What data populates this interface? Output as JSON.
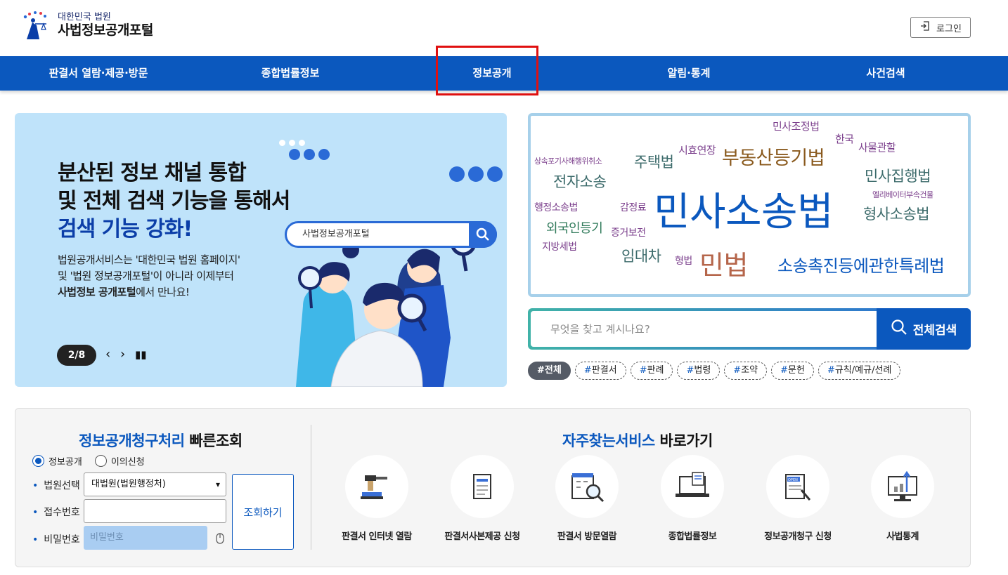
{
  "header": {
    "logo_small": "대한민국 법원",
    "logo_big": "사법정보공개포털",
    "login_label": "로그인"
  },
  "nav": [
    "판결서 열람·제공·방문",
    "종합법률정보",
    "정보공개",
    "알림·통계",
    "사건검색"
  ],
  "banner": {
    "title_line1": "분산된 정보 채널 통합",
    "title_line2": "및 전체 검색 기능을 통해서",
    "title_line3": "검색 기능 강화!",
    "desc_line1": "법원공개서비스는 '대한민국 법원 홈페이지'",
    "desc_line2": "및 '법원 정보공개포털'이 아니라 이제부터",
    "desc_line3_bold": "사법정보 공개포털",
    "desc_line3_rest": "에서 만나요!",
    "search_text": "사법정보공개포털",
    "pager": "2/8"
  },
  "word_cloud": [
    {
      "text": "민사조정법",
      "color": "#7b3f8c"
    },
    {
      "text": "한국",
      "color": "#7b3f8c"
    },
    {
      "text": "사물관할",
      "color": "#7b3f8c"
    },
    {
      "text": "시효연장",
      "color": "#7b3f8c"
    },
    {
      "text": "부동산등기법",
      "color": "#8a5a1e"
    },
    {
      "text": "상속포기사해행위취소",
      "color": "#7b3f8c"
    },
    {
      "text": "주택법",
      "color": "#3c6b6b"
    },
    {
      "text": "민사집행법",
      "color": "#3c6b6b"
    },
    {
      "text": "전자소송",
      "color": "#3c6b6b"
    },
    {
      "text": "엘리베이터부속건물",
      "color": "#7b3f8c"
    },
    {
      "text": "행정소송법",
      "color": "#7b3f8c"
    },
    {
      "text": "감정료",
      "color": "#7b3f8c"
    },
    {
      "text": "민사소송법",
      "color": "#0b58be"
    },
    {
      "text": "형사소송법",
      "color": "#3c6b6b"
    },
    {
      "text": "외국인등기",
      "color": "#2f7a5a"
    },
    {
      "text": "증거보전",
      "color": "#7b3f8c"
    },
    {
      "text": "지방세법",
      "color": "#7b3f8c"
    },
    {
      "text": "임대차",
      "color": "#3c6b6b"
    },
    {
      "text": "형법",
      "color": "#7b3f8c"
    },
    {
      "text": "민법",
      "color": "#b5654a"
    },
    {
      "text": "소송촉진등에관한특례법",
      "color": "#0b58be"
    }
  ],
  "search": {
    "placeholder": "무엇을 찾고 계시나요?",
    "button_label": "전체검색"
  },
  "tags": [
    "전체",
    "판결서",
    "판례",
    "법령",
    "조약",
    "문헌",
    "규칙/예규/선례"
  ],
  "quick": {
    "title_blue": "정보공개청구처리",
    "title_rest": " 빠른조회",
    "radio_1": "정보공개",
    "radio_2": "이의신청",
    "court_label": "법원선택",
    "court_value": "대법원(법원행정처)",
    "receipt_label": "접수번호",
    "password_label": "비밀번호",
    "password_placeholder": "비밀번호",
    "query_button": "조회하기"
  },
  "services": {
    "title_blue": "자주찾는서비스",
    "title_rest": " 바로가기",
    "items": [
      {
        "label": "판결서 인터넷 열람",
        "icon": "gavel-icon"
      },
      {
        "label": "판결서사본제공 신청",
        "icon": "document-icon"
      },
      {
        "label": "판결서 방문열람",
        "icon": "building-search-icon"
      },
      {
        "label": "종합법률정보",
        "icon": "laptop-icon"
      },
      {
        "label": "정보공개청구 신청",
        "icon": "open-document-icon"
      },
      {
        "label": "사법통계",
        "icon": "statistics-monitor-icon"
      }
    ]
  }
}
